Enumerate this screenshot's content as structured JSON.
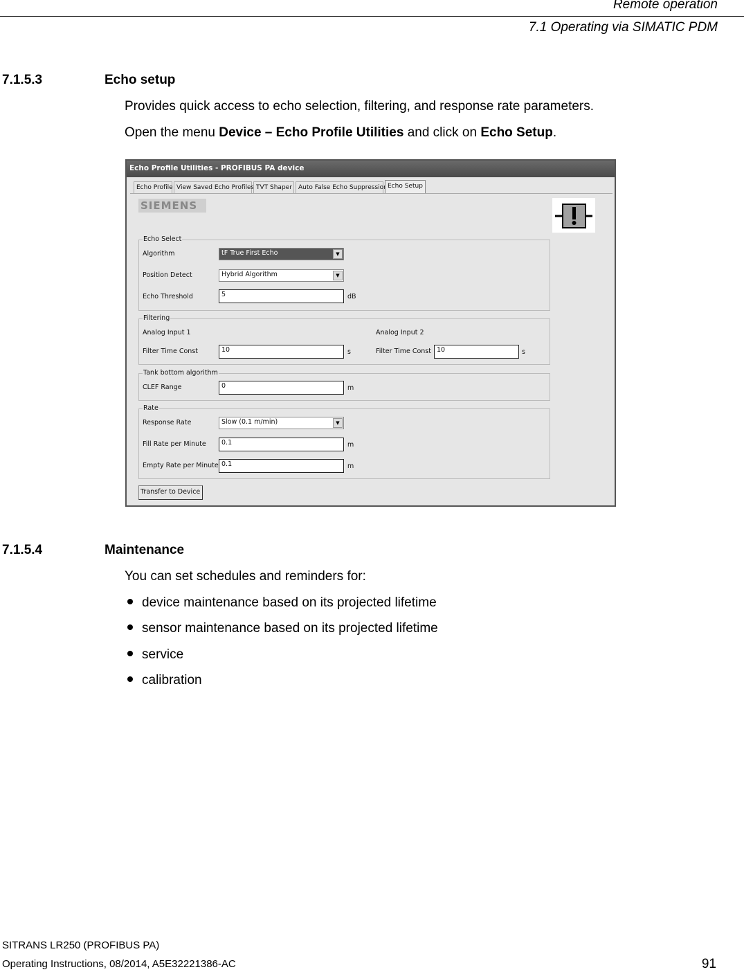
{
  "header": {
    "chapter": "Remote operation",
    "section": "7.1 Operating via SIMATIC PDM"
  },
  "echo_setup": {
    "number": "7.1.5.3",
    "title": "Echo setup",
    "intro": "Provides quick access to echo selection, filtering, and response rate parameters.",
    "instruction_prefix": "Open the menu ",
    "menu_path": "Device – Echo Profile Utilities",
    "instruction_middle": " and click on ",
    "menu_item": "Echo Setup",
    "instruction_suffix": "."
  },
  "screenshot": {
    "window_title": "Echo Profile Utilities - PROFIBUS PA device",
    "tabs": [
      {
        "label": "Echo Profile",
        "active": false
      },
      {
        "label": "View Saved Echo Profiles",
        "active": false
      },
      {
        "label": "TVT Shaper",
        "active": false
      },
      {
        "label": "Auto False Echo Suppression",
        "active": false
      },
      {
        "label": "Echo Setup",
        "active": true
      }
    ],
    "logo": "SIEMENS",
    "status_icon": "maintenance-alarm-icon",
    "echo_select": {
      "legend": "Echo Select",
      "algorithm_label": "Algorithm",
      "algorithm_value": "tF  True First Echo",
      "position_label": "Position Detect",
      "position_value": "Hybrid Algorithm",
      "threshold_label": "Echo Threshold",
      "threshold_value": "5",
      "threshold_unit": "dB"
    },
    "filtering": {
      "legend": "Filtering",
      "ai1_label": "Analog Input 1",
      "ai1_ftc_label": "Filter Time Const",
      "ai1_ftc_value": "10",
      "ai1_unit": "s",
      "ai2_label": "Analog Input 2",
      "ai2_ftc_label": "Filter Time Const",
      "ai2_ftc_value": "10",
      "ai2_unit": "s"
    },
    "tank_bottom": {
      "legend": "Tank bottom algorithm",
      "clef_label": "CLEF Range",
      "clef_value": "0",
      "clef_unit": "m"
    },
    "rate": {
      "legend": "Rate",
      "response_label": "Response Rate",
      "response_value": "Slow (0.1 m/min)",
      "fill_label": "Fill Rate per Minute",
      "fill_value": "0.1",
      "fill_unit": "m",
      "empty_label": "Empty Rate per Minute",
      "empty_value": "0.1",
      "empty_unit": "m"
    },
    "transfer_button": "Transfer to Device"
  },
  "maintenance": {
    "number": "7.1.5.4",
    "title": "Maintenance",
    "intro": "You can set schedules and reminders for:",
    "bullets": [
      "device maintenance based on its projected lifetime",
      "sensor maintenance based on its projected lifetime",
      "service",
      "calibration"
    ]
  },
  "footer": {
    "product": "SITRANS LR250 (PROFIBUS PA)",
    "doc_info": "Operating Instructions, 08/2014, A5E32221386-AC",
    "page_number": "91"
  }
}
